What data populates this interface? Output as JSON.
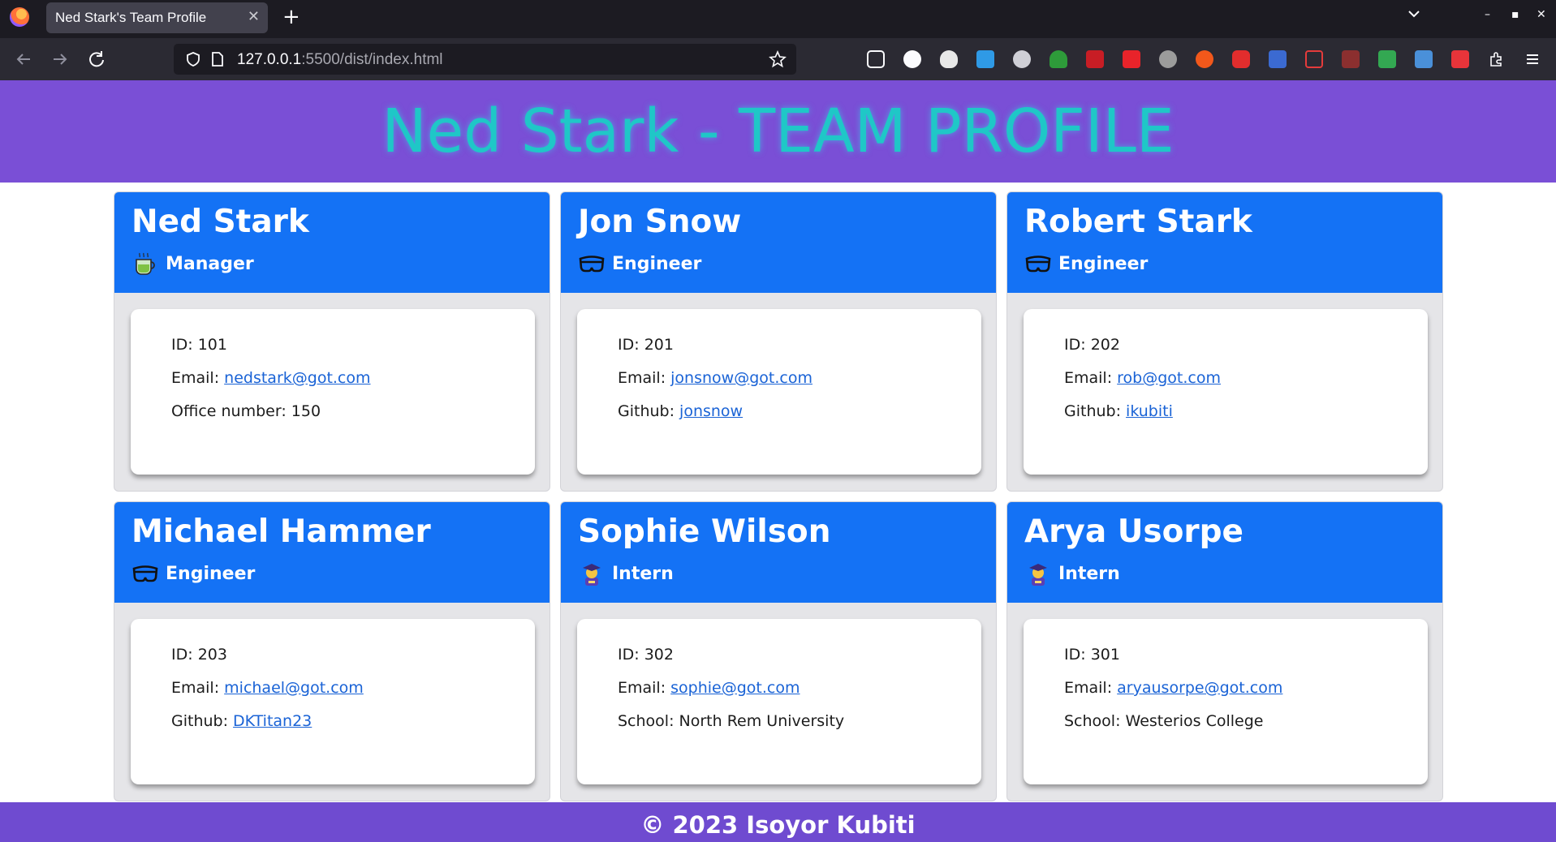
{
  "browser": {
    "tab_title": "Ned Stark's Team Profile",
    "tab_close": "✕",
    "new_tab": "+",
    "url_host": "127.0.0.1",
    "url_rest": ":5500/dist/index.html",
    "window_minimize": "–",
    "window_maximize": "▪",
    "window_close": "✕"
  },
  "header": {
    "title": "Ned Stark - TEAM PROFILE"
  },
  "labels": {
    "id": "ID: ",
    "email": "Email: ",
    "office": "Office number: ",
    "github": "Github: ",
    "school": "School: "
  },
  "team": [
    {
      "name": "Ned Stark",
      "role": "Manager",
      "icon": "tea-cup-icon",
      "id": "101",
      "email": "nedstark@got.com",
      "extra_label": "Office number: ",
      "extra_value": "150",
      "extra_is_link": false
    },
    {
      "name": "Jon Snow",
      "role": "Engineer",
      "icon": "glasses-icon",
      "id": "201",
      "email": "jonsnow@got.com",
      "extra_label": "Github: ",
      "extra_value": "jonsnow",
      "extra_is_link": true
    },
    {
      "name": "Robert Stark",
      "role": "Engineer",
      "icon": "glasses-icon",
      "id": "202",
      "email": "rob@got.com",
      "extra_label": "Github: ",
      "extra_value": "ikubiti",
      "extra_is_link": true
    },
    {
      "name": "Michael Hammer",
      "role": "Engineer",
      "icon": "glasses-icon",
      "id": "203",
      "email": "michael@got.com",
      "extra_label": "Github: ",
      "extra_value": "DKTitan23",
      "extra_is_link": true
    },
    {
      "name": "Sophie Wilson",
      "role": "Intern",
      "icon": "student-icon",
      "id": "302",
      "email": "sophie@got.com",
      "extra_label": "School: ",
      "extra_value": "North Rem University",
      "extra_is_link": false
    },
    {
      "name": "Arya Usorpe",
      "role": "Intern",
      "icon": "student-icon",
      "id": "301",
      "email": "aryausorpe@got.com",
      "extra_label": "School: ",
      "extra_value": "Westerios College",
      "extra_is_link": false
    }
  ],
  "footer": {
    "text": "© 2023 Isoyor Kubiti"
  },
  "colors": {
    "header_bg": "#7a4fd6",
    "title_color": "#1fc7c7",
    "card_head": "#1472f5",
    "link": "#1a63d6",
    "footer_bg": "#6f4bd0"
  }
}
